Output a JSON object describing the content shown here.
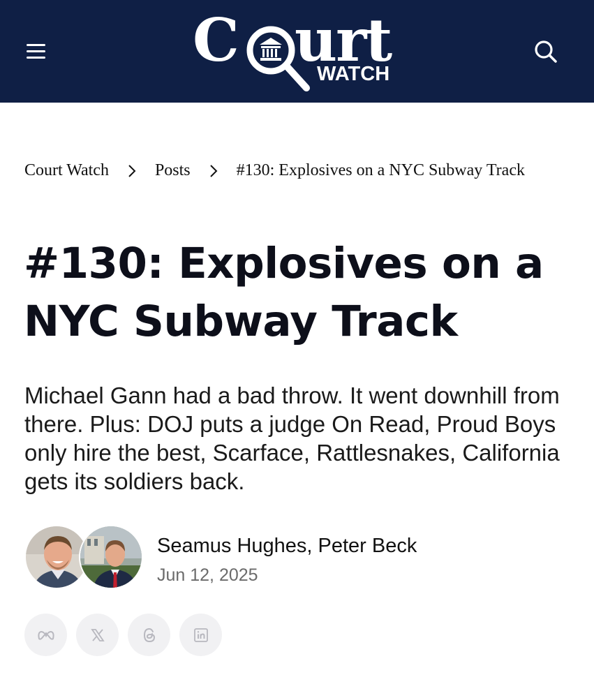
{
  "header": {
    "logo_main_left": "C",
    "logo_main_right": "urt",
    "logo_sub": "WATCH",
    "menu_icon": "hamburger-menu-icon",
    "search_icon": "search-icon",
    "bg_color": "#0f1f45"
  },
  "breadcrumb": {
    "items": [
      {
        "label": "Court Watch"
      },
      {
        "label": "Posts"
      },
      {
        "label": "#130: Explosives on a NYC Subway Track"
      }
    ],
    "separator_icon": "chevron-right-icon"
  },
  "article": {
    "title_line1": "#130: Explosives on a",
    "title_line2": "NYC Subway Track",
    "subtitle": "Michael Gann had a bad throw. It went downhill from there. Plus: DOJ puts a judge On Read, Proud Boys only hire the best, Scarface, Rattlesnakes, California gets its soldiers back.",
    "authors": "Seamus Hughes, Peter Beck",
    "date": "Jun 12, 2025"
  },
  "share": {
    "buttons": [
      {
        "icon": "meta-icon"
      },
      {
        "icon": "x-icon"
      },
      {
        "icon": "threads-icon"
      },
      {
        "icon": "linkedin-icon"
      }
    ]
  }
}
